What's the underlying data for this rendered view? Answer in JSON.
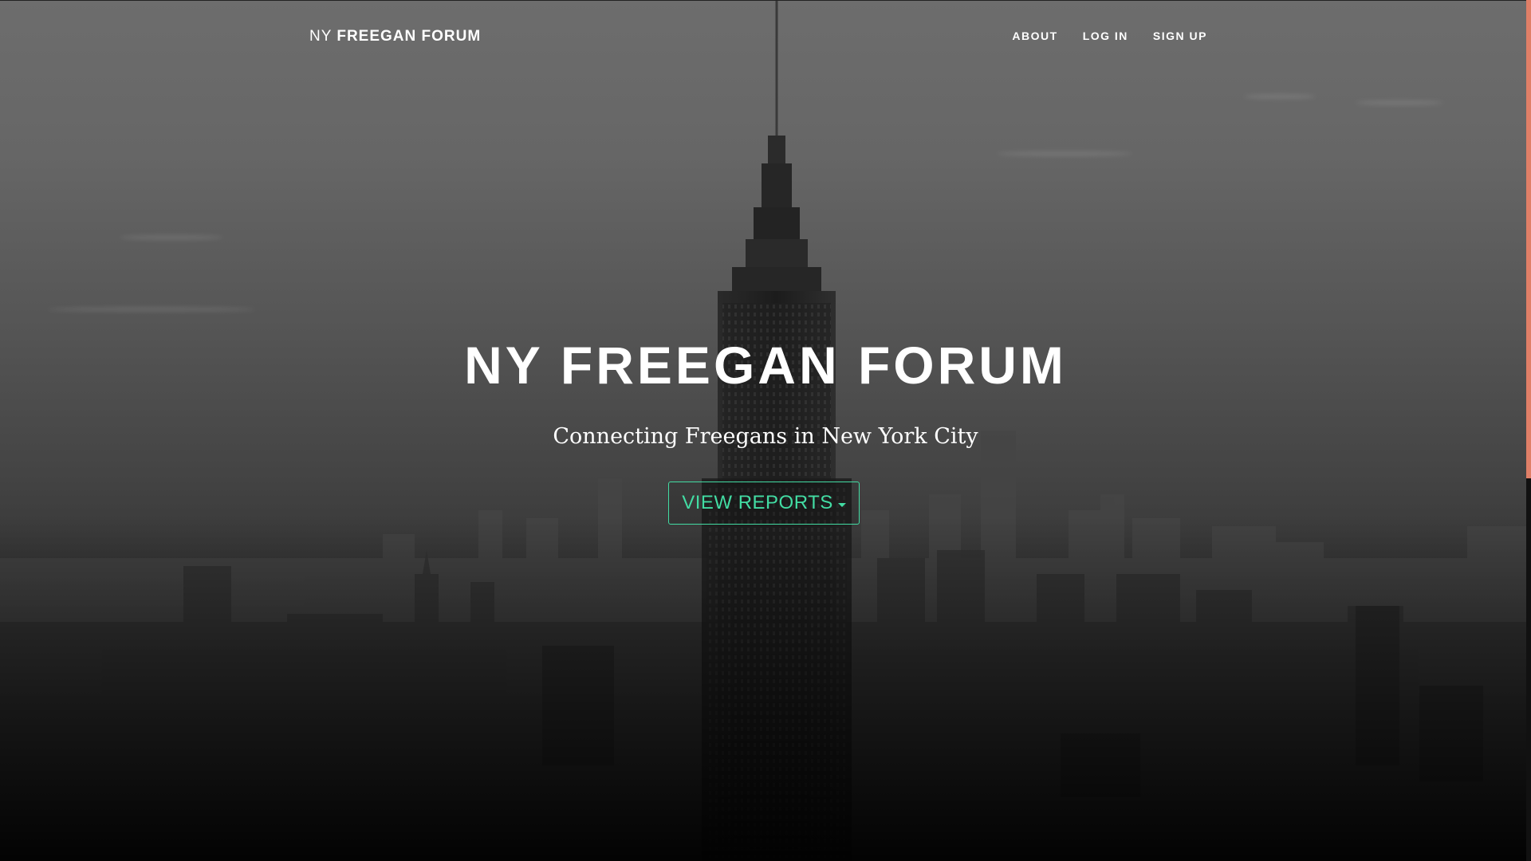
{
  "nav": {
    "brand_light": "NY",
    "brand_bold": "FREEGAN FORUM",
    "links": [
      {
        "label": "ABOUT"
      },
      {
        "label": "LOG IN"
      },
      {
        "label": "SIGN UP"
      }
    ]
  },
  "hero": {
    "title": "NY FREEGAN FORUM",
    "tagline": "Connecting Freegans in New York City",
    "button_label": "VIEW REPORTS"
  },
  "colors": {
    "accent": "#42dca3",
    "scrollbar_thumb": "#e07f67",
    "text": "#ffffff"
  },
  "icons": {
    "dropdown": "caret-down-icon"
  }
}
